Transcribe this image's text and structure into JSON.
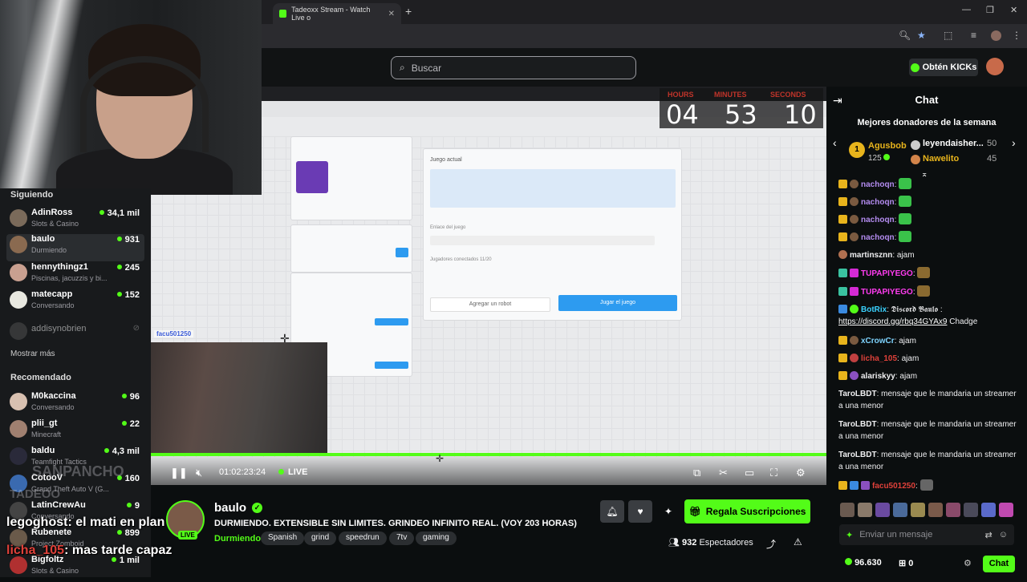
{
  "browser": {
    "tab_title": "Tadeoxx Stream - Watch Live o",
    "new_tab": "+",
    "window_controls": [
      "—",
      "❐",
      "✕"
    ]
  },
  "header": {
    "search_placeholder": "Buscar",
    "get_kicks": "Obtén KICKs"
  },
  "sidebar": {
    "following_title": "Siguiendo",
    "following": [
      {
        "name": "AdinRoss",
        "category": "Slots & Casino",
        "viewers": "34,1 mil",
        "color": "#7a6a5a"
      },
      {
        "name": "baulo",
        "category": "Durmiendo",
        "viewers": "931",
        "color": "#8a6a50",
        "active": true
      },
      {
        "name": "hennythingz1",
        "category": "Piscinas, jacuzzis y bi...",
        "viewers": "245",
        "color": "#c9a090"
      },
      {
        "name": "matecapp",
        "category": "Conversando",
        "viewers": "152",
        "color": "#e8e8e0"
      },
      {
        "name": "addisynobrien",
        "category": "",
        "viewers": "",
        "color": "#555"
      }
    ],
    "show_more": "Mostrar más",
    "recommended_title": "Recomendado",
    "recommended": [
      {
        "name": "M0kaccina",
        "category": "Conversando",
        "viewers": "96",
        "color": "#d8c0b0"
      },
      {
        "name": "plii_gt",
        "category": "Minecraft",
        "viewers": "22",
        "color": "#a08070"
      },
      {
        "name": "baldu",
        "category": "Teamfight Tactics",
        "viewers": "4,3 mil",
        "color": "#2a2a3a"
      },
      {
        "name": "CotooV",
        "category": "Grand Theft Auto V (G...",
        "viewers": "160",
        "color": "#3a6ab0"
      },
      {
        "name": "LatinCrewAu",
        "category": "Conversando",
        "viewers": "9",
        "color": "#444"
      },
      {
        "name": "Rubenete",
        "category": "Project Zomboid",
        "viewers": "899",
        "color": "#6a5a4a"
      },
      {
        "name": "Bigfoltz",
        "category": "Slots & Casino",
        "viewers": "1 mil",
        "color": "#b03030"
      }
    ]
  },
  "overlay": {
    "line1_user": "legoghost",
    "line1_msg": ": el mati en plan",
    "line2_user": "licha_105",
    "line2_msg": ": mas tarde capaz",
    "faded_name": "SANPANCHO",
    "faded_sub": "TADEOO"
  },
  "video": {
    "timer": {
      "hours_label": "HOURS",
      "minutes_label": "MINUTES",
      "seconds_label": "SECONDS",
      "hours": "04",
      "minutes": "53",
      "seconds": "10"
    },
    "inner": {
      "current_game": "Juego actual",
      "add_robot": "Agregar un robot",
      "play_button": "Jugar el juego",
      "link_label": "Enlace del juego",
      "players_label": "Jugadores conectados 11/20",
      "overlay_name": "facu501250"
    },
    "time": "01:02:23:24",
    "live": "LIVE"
  },
  "stream": {
    "name": "baulo",
    "live_badge": "LIVE",
    "title": "DURMIENDO. EXTENSIBLE SIN LIMITES. GRINDEO INFINITO REAL. (VOY 203 HORAS)",
    "category": "Durmiendo",
    "tags": [
      "Spanish",
      "grind",
      "speedrun",
      "7tv",
      "gaming"
    ],
    "subs_button": "Regala Suscripciones",
    "viewers": "932",
    "viewers_label": "Espectadores"
  },
  "chat": {
    "title": "Chat",
    "donors_title": "Mejores donadores de la semana",
    "donors": [
      {
        "rank": "1",
        "name": "Agusbob",
        "amount": "125"
      },
      {
        "name": "leyendaisher...",
        "amount": "50"
      },
      {
        "name": "Nawelito",
        "amount": "45"
      }
    ],
    "messages": [
      {
        "user": "nachoqn",
        "text": ":",
        "color": "#b48cf0"
      },
      {
        "user": "nachoqn",
        "text": ":",
        "color": "#b48cf0"
      },
      {
        "user": "nachoqn",
        "text": ":",
        "color": "#b48cf0"
      },
      {
        "user": "nachoqn",
        "text": ":",
        "color": "#b48cf0"
      },
      {
        "user": "martinsznn",
        "text": ": ajam",
        "color": "#efeff1"
      },
      {
        "user": "TUPAPIYEGO",
        "text": ":",
        "color": "#ff3cf0"
      },
      {
        "user": "TUPAPIYEGO",
        "text": ":",
        "color": "#ff3cf0"
      },
      {
        "user": "BotRix",
        "text": ": 𝕯𝖎𝖘𝖈𝖔𝖗𝖉 𝕭𝖆𝖚𝖑𝖔 :",
        "color": "#3ad2ff"
      },
      {
        "user": "xCrowCr",
        "text": ": ajam",
        "color": "#7fd4ff"
      },
      {
        "user": "licha_105",
        "text": ": ajam",
        "color": "#e0413a"
      },
      {
        "user": "alariskyy",
        "text": ": ajam",
        "color": "#efeff1"
      },
      {
        "user": "TaroLBDT",
        "text": ": mensaje que le mandaria un streamer a una menor",
        "color": "#efeff1"
      },
      {
        "user": "TaroLBDT",
        "text": ": mensaje que le mandaria un streamer a una menor",
        "color": "#efeff1"
      },
      {
        "user": "TaroLBDT",
        "text": ": mensaje que le mandaria un streamer a una menor",
        "color": "#efeff1"
      },
      {
        "user": "facu501250",
        "text": ":",
        "color": "#e0413a"
      }
    ],
    "botrix_link": "https://discord.gg/rbq34GYAx9",
    "botrix_after": " Chadge",
    "input_placeholder": "Enviar un mensaje",
    "coins": "96.630",
    "gifts": "0",
    "send": "Chat"
  },
  "colors": {
    "accent": "#53fc18",
    "bg": "#0b0e0f"
  }
}
